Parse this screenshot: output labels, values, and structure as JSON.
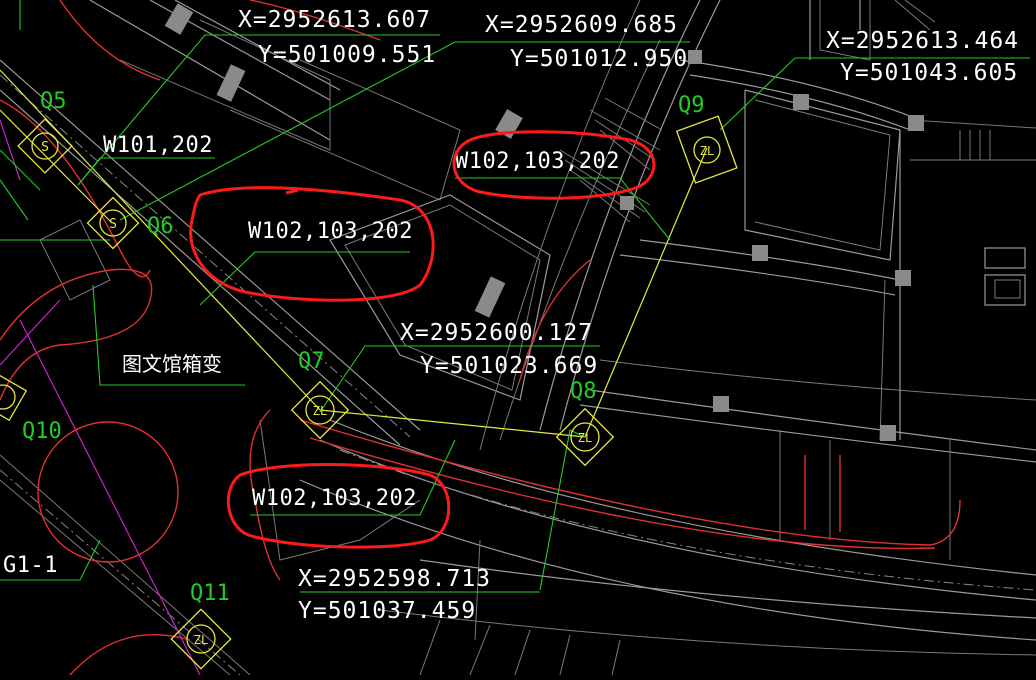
{
  "drawing": {
    "background_color": "#000000",
    "colors": {
      "leader_green": "#22cc22",
      "boundary_red": "#e03030",
      "cable_yellow": "#e8e840",
      "annotation_red": "#ff1a1a",
      "linework_gray": "#9a9a9a",
      "magenta": "#cc22cc"
    },
    "coordinates": [
      {
        "id": "c1",
        "x": "X=2952613.607",
        "y": "Y=501009.551"
      },
      {
        "id": "c2",
        "x": "X=2952609.685",
        "y": "Y=501012.950"
      },
      {
        "id": "c3",
        "x": "X=2952613.464",
        "y": "Y=501043.605"
      },
      {
        "id": "c4",
        "x": "X=2952600.127",
        "y": "Y=501023.669"
      },
      {
        "id": "c5",
        "x": "X=2952598.713",
        "y": "Y=501037.459"
      }
    ],
    "wells": [
      {
        "id": "Q5",
        "label": "Q5",
        "symbol": "S"
      },
      {
        "id": "Q6",
        "label": "Q6",
        "symbol": "S"
      },
      {
        "id": "Q7",
        "label": "Q7",
        "symbol": "ZL"
      },
      {
        "id": "Q8",
        "label": "Q8",
        "symbol": "ZL"
      },
      {
        "id": "Q9",
        "label": "Q9",
        "symbol": "ZL"
      },
      {
        "id": "Q10",
        "label": "Q10",
        "symbol": ""
      },
      {
        "id": "Q11",
        "label": "Q11",
        "symbol": "ZL"
      }
    ],
    "cable_labels": [
      {
        "id": "w1",
        "text": "W101,202",
        "highlighted": false
      },
      {
        "id": "w2",
        "text": "W102,103,202",
        "highlighted": true
      },
      {
        "id": "w3",
        "text": "W102,103,202",
        "highlighted": true
      },
      {
        "id": "w4",
        "text": "W102,103,202",
        "highlighted": true
      }
    ],
    "other_labels": {
      "substation": "图文馆箱变",
      "g1": "G1-1"
    }
  }
}
